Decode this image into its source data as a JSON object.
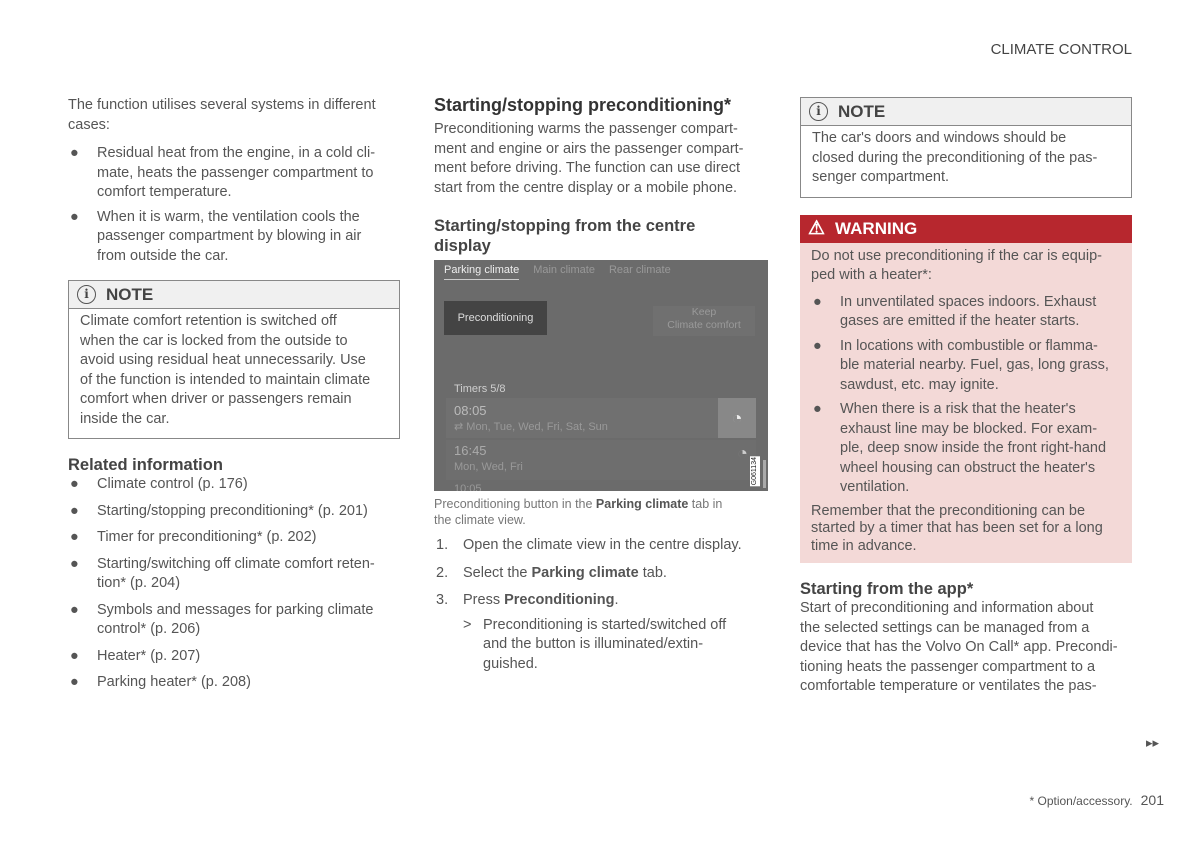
{
  "header": {
    "section": "CLIMATE CONTROL"
  },
  "col1": {
    "intro": "The function utilises several systems in different\ncases:",
    "bullets": [
      "Residual heat from the engine, in a cold cli-\nmate, heats the passenger compartment to\ncomfort temperature.",
      "When it is warm, the ventilation cools the\npassenger compartment by blowing in air\nfrom outside the car."
    ],
    "note_title": "NOTE",
    "note_text": "Climate comfort retention is switched off\nwhen the car is locked from the outside to\navoid using residual heat unnecessarily. Use\nof the function is intended to maintain climate\ncomfort when driver or passengers remain\ninside the car.",
    "related_title": "Related information",
    "related": [
      "Climate control (p. 176)",
      "Starting/stopping preconditioning* (p. 201)",
      "Timer for preconditioning* (p. 202)",
      "Starting/switching off climate comfort reten-\ntion* (p. 204)",
      "Symbols and messages for parking climate\ncontrol* (p. 206)",
      "Heater* (p. 207)",
      "Parking heater* (p. 208)"
    ]
  },
  "col2": {
    "title": "Starting/stopping preconditioning*",
    "intro": "Preconditioning warms the passenger compart-\nment and engine or airs the passenger compart-\nment before driving. The function can use direct\nstart from the centre display or a mobile phone.",
    "subtitle": "Starting/stopping from the centre\ndisplay",
    "screen": {
      "tabs": [
        "Parking climate",
        "Main climate",
        "Rear climate"
      ],
      "precond_button": "Preconditioning",
      "keep_button": "Keep\nClimate comfort",
      "timers_label": "Timers 5/8",
      "timers": [
        {
          "time": "08:05",
          "days": "Mon, Tue, Wed, Fri, Sat, Sun"
        },
        {
          "time": "16:45",
          "days": "Mon, Wed, Fri"
        },
        {
          "time": "10:05",
          "days": ""
        }
      ],
      "image_code": "G061134"
    },
    "caption_pre": "Preconditioning button in the ",
    "caption_bold": "Parking climate",
    "caption_post": " tab in\nthe climate view.",
    "steps": [
      {
        "n": "1.",
        "pre": "Open the climate view in the centre display.",
        "bold": "",
        "post": ""
      },
      {
        "n": "2.",
        "pre": "Select the ",
        "bold": "Parking climate",
        "post": " tab."
      },
      {
        "n": "3.",
        "pre": "Press ",
        "bold": "Preconditioning",
        "post": "."
      }
    ],
    "result_marker": ">",
    "result": "Preconditioning is started/switched off\nand the button is illuminated/extin-\nguished."
  },
  "col3": {
    "note_title": "NOTE",
    "note_text": "The car's doors and windows should be\nclosed during the preconditioning of the pas-\nsenger compartment.",
    "warn_title": "WARNING",
    "warn_intro": "Do not use preconditioning if the car is equip-\nped with a heater*:",
    "warn_bullets": [
      "In unventilated spaces indoors. Exhaust\ngases are emitted if the heater starts.",
      "In locations with combustible or flamma-\nble material nearby. Fuel, gas, long grass,\nsawdust, etc. may ignite.",
      "When there is a risk that the heater's\nexhaust line may be blocked. For exam-\nple, deep snow inside the front right-hand\nwheel housing can obstruct the heater's\nventilation."
    ],
    "warn_outro": "Remember that the preconditioning can be\nstarted by a timer that has been set for a long\ntime in advance.",
    "app_title": "Starting from the app*",
    "app_text": "Start of preconditioning and information about\nthe selected settings can be managed from a\ndevice that has the Volvo On Call* app. Precondi-\ntioning heats the passenger compartment to a\ncomfortable temperature or ventilates the pas-"
  },
  "footer": {
    "continue": "▸▸",
    "footnote": "* Option/accessory.",
    "page": "201"
  },
  "colors": {
    "warning": "#b7272e",
    "warning_bg": "#f3d9d7",
    "note_header": "#f0f0f0"
  }
}
